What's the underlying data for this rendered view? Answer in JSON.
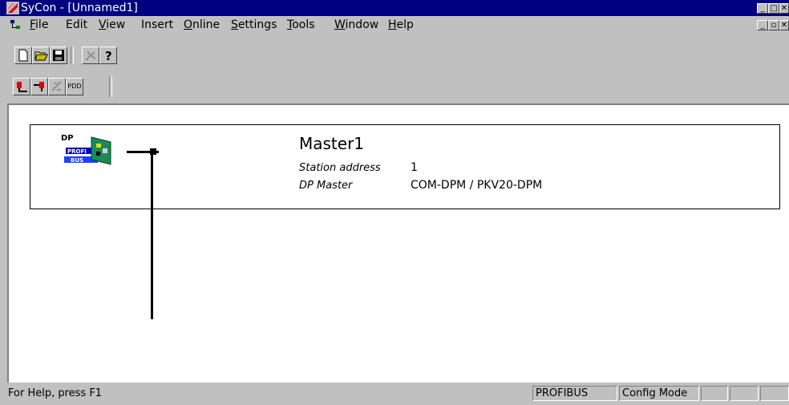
{
  "window": {
    "title": "SyCon - [Unnamed1]",
    "controls": {
      "minimize": "_",
      "maximize": "□",
      "close": "✕",
      "restore": "▫"
    }
  },
  "menu": {
    "items": [
      {
        "accel": "F",
        "rest": "ile"
      },
      {
        "accel": "",
        "rest": "Edit"
      },
      {
        "accel": "V",
        "rest": "iew"
      },
      {
        "accel": "",
        "rest": "Insert"
      },
      {
        "accel": "O",
        "rest": "nline"
      },
      {
        "accel": "S",
        "rest": "ettings"
      },
      {
        "accel": "T",
        "rest": "ools"
      },
      {
        "accel": "W",
        "rest": "indow"
      },
      {
        "accel": "H",
        "rest": "elp"
      }
    ]
  },
  "toolbar1": {
    "icons": [
      "new-document-icon",
      "open-folder-icon",
      "save-icon",
      "scan-icon",
      "help-question-icon"
    ]
  },
  "toolbar2": {
    "icons": [
      "insert-master-icon",
      "insert-slave-icon",
      "disabled-tool-icon",
      "pdd-icon"
    ],
    "pdd_label": "PDD"
  },
  "master": {
    "name": "Master1",
    "station_address_label": "Station address",
    "station_address_value": "1",
    "dp_master_label": "DP Master",
    "dp_master_value": "COM-DPM / PKV20-DPM",
    "icon_text_dp": "DP",
    "icon_text_profibus": "PROFI",
    "icon_text_bus": "BUS"
  },
  "status": {
    "help": "For Help, press F1",
    "protocol": "PROFIBUS",
    "mode": "Config Mode"
  },
  "colors": {
    "titlebar": "#000080",
    "chrome": "#c0c0c0",
    "workspace": "#ffffff"
  }
}
